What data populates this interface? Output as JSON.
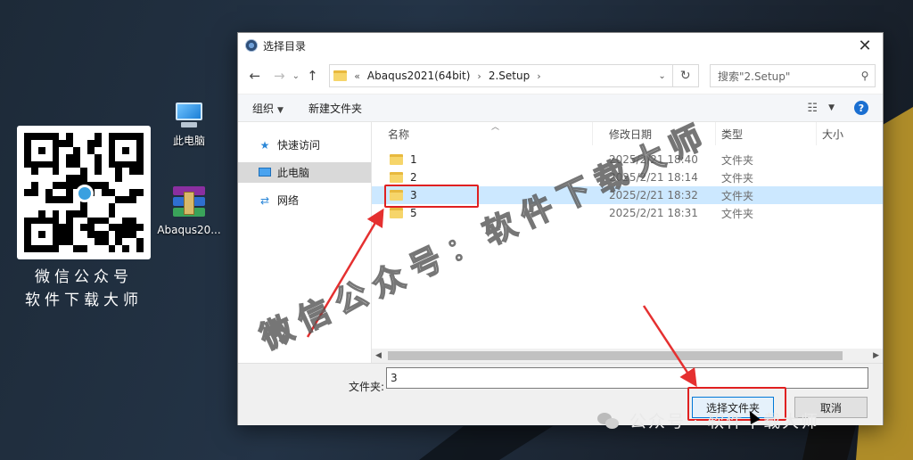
{
  "desktop": {
    "icons": [
      {
        "label": "此电脑"
      },
      {
        "label": "Abaqus20..."
      }
    ],
    "qr_caption": [
      "微信公众号",
      "软件下载大师"
    ]
  },
  "dialog": {
    "title": "选择目录",
    "close_glyph": "✕",
    "nav": {
      "back": "←",
      "forward": "→",
      "recent": "⌄",
      "up": "↑"
    },
    "address": {
      "prefix": "«",
      "crumbs": [
        "Abaqus2021(64bit)",
        "2.Setup"
      ],
      "separator": "›",
      "dropdown": "⌄",
      "refresh": "↻"
    },
    "search": {
      "placeholder": "搜索\"2.Setup\"",
      "icon": "⚲"
    },
    "commands": {
      "organize": "组织",
      "new_folder": "新建文件夹",
      "caret": "▼",
      "help": "?",
      "view_icon": "☷"
    },
    "nav_pane": [
      {
        "label": "快速访问",
        "icon": "star-icon",
        "selected": false
      },
      {
        "label": "此电脑",
        "icon": "computer-icon",
        "selected": true
      },
      {
        "label": "网络",
        "icon": "network-icon",
        "selected": false
      }
    ],
    "columns": [
      "名称",
      "修改日期",
      "类型",
      "大小"
    ],
    "files": [
      {
        "name": "1",
        "date": "2025/2/21 18:40",
        "type": "文件夹",
        "selected": false
      },
      {
        "name": "2",
        "date": "2025/2/21 18:14",
        "type": "文件夹",
        "selected": false
      },
      {
        "name": "3",
        "date": "2025/2/21 18:32",
        "type": "文件夹",
        "selected": true
      },
      {
        "name": "5",
        "date": "2025/2/21 18:31",
        "type": "文件夹",
        "selected": false
      }
    ],
    "folder_label": "文件夹:",
    "folder_value": "3",
    "buttons": {
      "select": "选择文件夹",
      "cancel": "取消"
    }
  },
  "watermarks": {
    "diagonal": "微信公众号：软件下载大师",
    "bottom": "公众号 · 软件下载大师"
  },
  "colors": {
    "highlight": "#e02020",
    "selection": "#cce8ff",
    "accent": "#0078d7"
  }
}
